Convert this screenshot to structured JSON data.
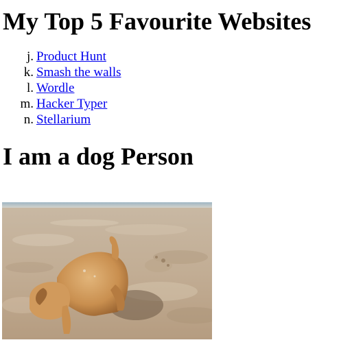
{
  "page": {
    "title": "My Top 5 Favourite Websites",
    "sites": [
      {
        "marker": "j.",
        "label": "Product Hunt"
      },
      {
        "marker": "k.",
        "label": "Smash the walls"
      },
      {
        "marker": "l.",
        "label": "Wordle"
      },
      {
        "marker": "m.",
        "label": "Hacker Typer"
      },
      {
        "marker": "n.",
        "label": "Stellarium"
      }
    ],
    "section_heading": "I am a dog Person",
    "image": {
      "subject": "puppy digging in beach sand"
    }
  },
  "colors": {
    "link": "#0000ee",
    "text": "#000000",
    "background": "#ffffff"
  }
}
